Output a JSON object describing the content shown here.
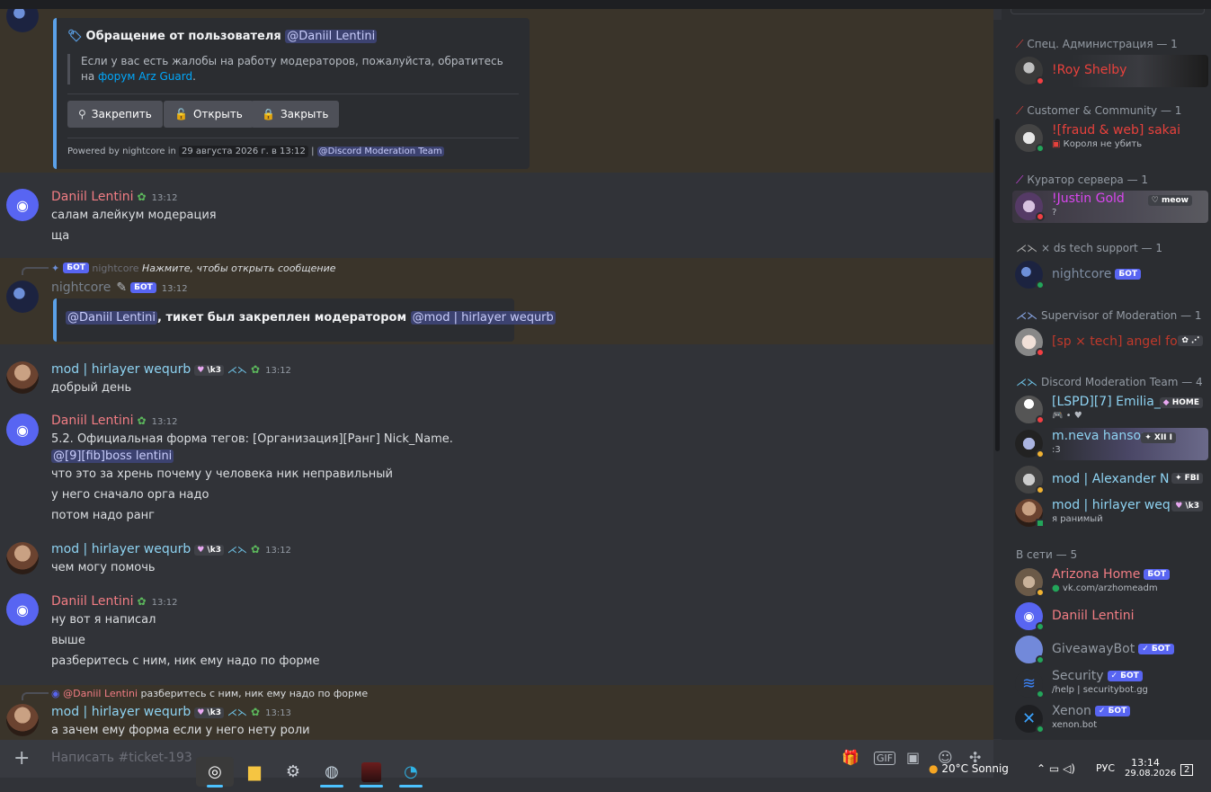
{
  "embed": {
    "title": "Обращение от пользователя",
    "title_mention": "@Daniil Lentini",
    "body": "Если у вас есть жалобы на работу модераторов, пожалуйста, обратитесь на",
    "link": "форум Arz Guard",
    "body_end": ".",
    "buttons": [
      "Закрепить",
      "Открыть",
      "Закрыть"
    ],
    "powered_prefix": "Powered by nightcore in",
    "powered_date": "29 августа 2026 г. в 13:12",
    "powered_sep": "|",
    "powered_mention": "@Discord Moderation Team"
  },
  "messages": [
    {
      "author": "Daniil Lentini",
      "time": "13:12",
      "lines": [
        "салам алейкум модерация",
        "ща"
      ]
    },
    {
      "reply_badge": "БОТ",
      "reply_author": "nightcore",
      "reply_text": "Нажмите, чтобы открыть сообщение",
      "author": "nightcore",
      "badge": "БОТ",
      "time": "13:12",
      "embed_mention1": "@Daniil Lentini",
      "embed_text": ", тикет был закреплен модератором",
      "embed_mention2": "@mod | hirlayer wequrb"
    },
    {
      "author": "mod | hirlayer wequrb",
      "tag": "\\k3",
      "time": "13:12",
      "lines": [
        "добрый день"
      ]
    },
    {
      "author": "Daniil Lentini",
      "time": "13:12",
      "lines": [
        "5.2. Официальная форма тегов: [Организация][Ранг] Nick_Name."
      ],
      "mention": "@[9][fib]boss lentini",
      "lines2": [
        "что это за хрень почему у человека ник неправильный",
        "у него сначало орга надо",
        "потом надо ранг"
      ]
    },
    {
      "author": "mod | hirlayer wequrb",
      "tag": "\\k3",
      "time": "13:12",
      "lines": [
        "чем могу помочь"
      ]
    },
    {
      "author": "Daniil Lentini",
      "time": "13:12",
      "lines": [
        "ну вот я написал",
        "выше",
        "разберитесь с ним, ник ему надо по форме"
      ]
    },
    {
      "reply_author": "@Daniil Lentini",
      "reply_text": "разберитесь с ним, ник ему надо по форме",
      "author": "mod | hirlayer wequrb",
      "tag": "\\k3",
      "time": "13:13",
      "lines": [
        "а зачем ему форма если у него нету роли"
      ]
    }
  ],
  "composer": {
    "placeholder": "Написать #ticket-193"
  },
  "members": {
    "groups": [
      {
        "label": "Спец. Администрация — 1",
        "members": [
          {
            "name": "!Roy Shelby",
            "color": "#e8413c",
            "status": "dnd"
          }
        ]
      },
      {
        "label": "Customer & Community — 1",
        "members": [
          {
            "name": "![fraud & web] sakai",
            "sub": "Короля не убить",
            "color": "#e8413c",
            "status": "online"
          }
        ]
      },
      {
        "label": "Куратор сервера — 1",
        "members": [
          {
            "name": "!Justin Gold",
            "sub": "?",
            "tag": "meow",
            "color": "#d946ef",
            "status": "dnd"
          }
        ]
      },
      {
        "label": "× ds tech support — 1",
        "members": [
          {
            "name": "nightcore",
            "badge": "БОТ",
            "color": "#7f8ea3",
            "status": "online"
          }
        ]
      },
      {
        "label": "Supervisor of Moderation — 1",
        "members": [
          {
            "name": "[sp × tech] angel fo",
            "tag": "✿ ⋰",
            "color": "#c0392b",
            "status": "dnd"
          }
        ]
      },
      {
        "label": "Discord Moderation Team — 4",
        "members": [
          {
            "name": "[LSPD][7] Emilia_",
            "sub": "🎮 • ♥",
            "tag": "HOME",
            "color": "#8ed3f2",
            "status": "dnd"
          },
          {
            "name": "m.neva hanson",
            "sub": ":3",
            "tag": "XII I",
            "color": "#8ed3f2",
            "status": "idle"
          },
          {
            "name": "mod | Alexander N",
            "tag": "FBI",
            "color": "#8ed3f2",
            "status": "idle"
          },
          {
            "name": "mod | hirlayer weq",
            "sub": "я ранимый",
            "tag": "\\k3",
            "color": "#8ed3f2",
            "status": "online"
          }
        ]
      },
      {
        "label": "В сети — 5",
        "members": [
          {
            "name": "Arizona Home",
            "badge": "БОТ",
            "sub": "vk.com/arzhomeadm",
            "color": "#f27d84",
            "status": "idle"
          },
          {
            "name": "Daniil Lentini",
            "color": "#f27d84",
            "status": "online"
          },
          {
            "name": "GiveawayBot",
            "badge": "✓ БОТ",
            "color": "#949ba4",
            "status": "online"
          },
          {
            "name": "Security",
            "badge": "✓ БОТ",
            "sub": "/help | securitybot.gg",
            "color": "#949ba4",
            "status": "online"
          },
          {
            "name": "Xenon",
            "badge": "✓ БОТ",
            "sub": "xenon.bot",
            "color": "#949ba4",
            "status": "online"
          }
        ]
      }
    ]
  },
  "taskbar": {
    "weather": "20°C  Sonnig",
    "lang": "РУС",
    "time": "13:14",
    "date": "29.08.2026",
    "notif": "2"
  }
}
